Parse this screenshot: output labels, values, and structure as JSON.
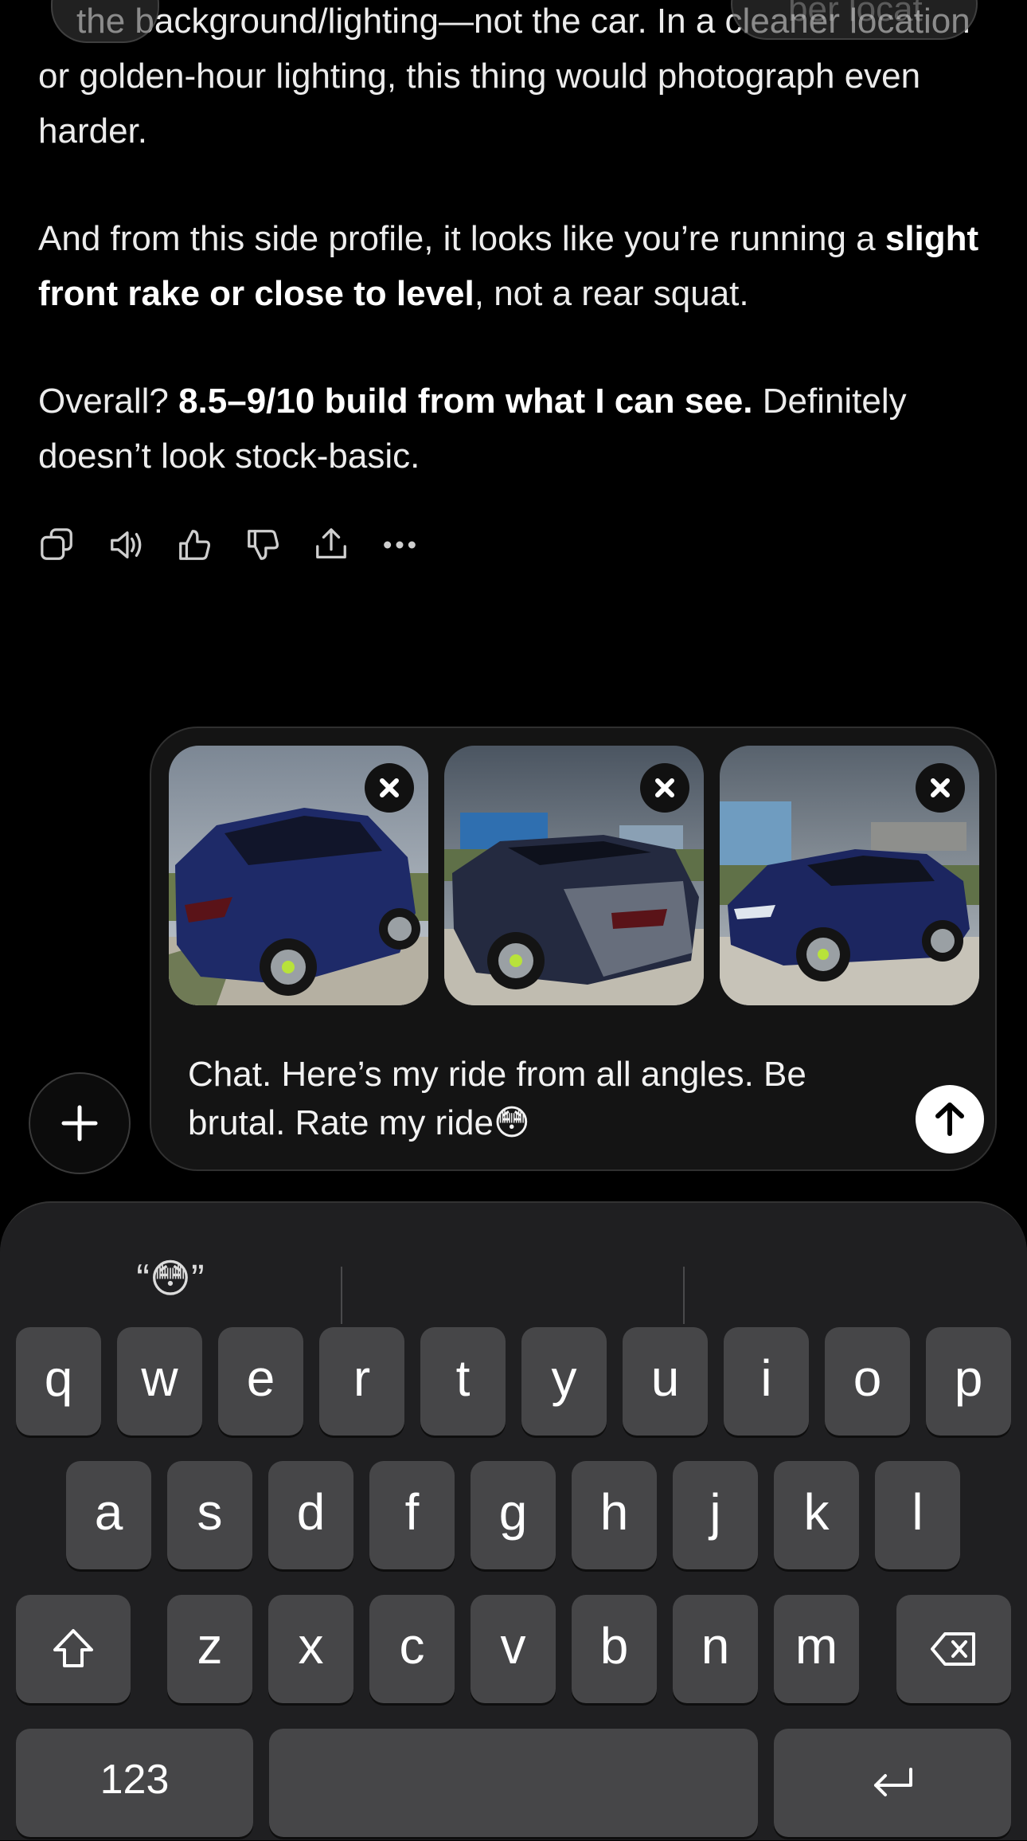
{
  "message": {
    "top_line": "the background/lighting—not the car. In a cleaner location",
    "p1_rest": "or golden-hour lighting, this thing would photograph even harder.",
    "p2_pre": "And from this side profile, it looks like you’re running a ",
    "p2_bold": "slight front rake or close to level",
    "p2_post": ", not a rear squat.",
    "p3_pre": "Overall? ",
    "p3_bold": "8.5–9/10 build from what I can see.",
    "p3_post": " Definitely doesn’t look stock-basic."
  },
  "floating": {
    "right_ghost": "ber locat"
  },
  "actions": [
    "copy-icon",
    "read-aloud-icon",
    "thumbs-up-icon",
    "thumbs-down-icon",
    "share-icon",
    "more-icon"
  ],
  "composer": {
    "attachments": [
      "car-photo-rear-quarter",
      "car-photo-rear-angle",
      "car-photo-front-quarter"
    ],
    "text": "Chat. Here’s my ride from all angles. Be brutal. Rate my ride😳"
  },
  "keyboard": {
    "suggestion": "“😳”",
    "row1": [
      "q",
      "w",
      "e",
      "r",
      "t",
      "y",
      "u",
      "i",
      "o",
      "p"
    ],
    "row2": [
      "a",
      "s",
      "d",
      "f",
      "g",
      "h",
      "j",
      "k",
      "l"
    ],
    "row3": [
      "z",
      "x",
      "c",
      "v",
      "b",
      "n",
      "m"
    ],
    "numbers_label": "123"
  },
  "colors": {
    "background": "#000000",
    "keyboard": "#1f1f21",
    "key": "#464648",
    "car_paint": "#1f2a66"
  }
}
